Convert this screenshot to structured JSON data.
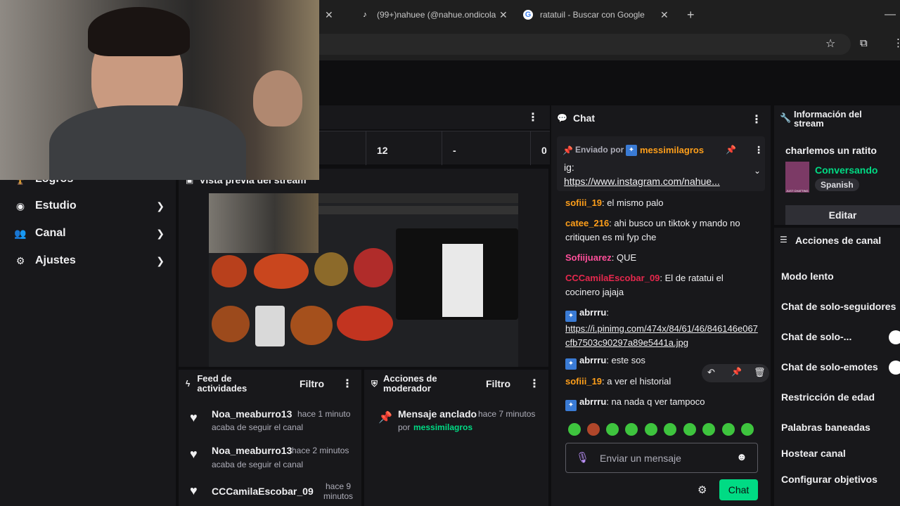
{
  "browser": {
    "tabs": [
      {
        "title": "(99+)nahuee (@nahue.ondicola",
        "icon": "tiktok-icon"
      },
      {
        "title": "ratatuil - Buscar con Google",
        "icon": "google-icon"
      }
    ]
  },
  "sidenav": {
    "items": [
      {
        "label": "Logros"
      },
      {
        "label": "Estudio"
      },
      {
        "label": "Canal"
      },
      {
        "label": "Ajustes"
      }
    ]
  },
  "stats": {
    "values": [
      "12",
      "-",
      "0"
    ]
  },
  "preview": {
    "title": "Vista previa del stream"
  },
  "feed": {
    "title": "Feed de actividades",
    "filter": "Filtro",
    "items": [
      {
        "user": "Noa_meaburro13",
        "time": "hace 1 minuto",
        "action": "acaba de seguir el canal"
      },
      {
        "user": "Noa_meaburro13",
        "time": "hace 2 minutos",
        "action": "acaba de seguir el canal"
      },
      {
        "user": "CCCamilaEscobar_09",
        "time": "hace 9 minutos",
        "action": ""
      }
    ]
  },
  "modactions": {
    "title": "Acciones de moderador",
    "filter": "Filtro",
    "pinned": {
      "label": "Mensaje anclado",
      "time": "hace 7 minutos",
      "by": "por",
      "user": "messimilagros"
    }
  },
  "chat": {
    "title": "Chat",
    "pinned": {
      "sent_by": "Enviado por",
      "user": "messimilagros",
      "text": "ig:",
      "link": "https://www.instagram.com/nahue..."
    },
    "messages": [
      {
        "user": "sofiii_19",
        "color": "#ff9f1a",
        "text": ": el mismo palo"
      },
      {
        "user": "catee_216",
        "color": "#ff9f1a",
        "text": ": ahi busco un tiktok y mando no critiquen es mi fyp che"
      },
      {
        "user": "Sofiijuarez",
        "color": "#ff4f9a",
        "text": ": QUE"
      },
      {
        "user": "CCCamilaEscobar_09",
        "color": "#e5284d",
        "text": ": El de ratatui el cocinero jajaja"
      },
      {
        "user": "abrrru",
        "color": "#efeff1",
        "text": ":",
        "link": "https://i.pinimg.com/474x/84/61/46/846146e067cfb7503c90297a89e5441a.jpg"
      },
      {
        "user": "abrrru",
        "color": "#efeff1",
        "text": ": este sos"
      },
      {
        "user": "sofiii_19",
        "color": "#ff9f1a",
        "text": ": a ver el historial"
      },
      {
        "user": "abrrru",
        "color": "#efeff1",
        "text": ": na nada q ver tampoco"
      }
    ],
    "input_placeholder": "Enviar un mensaje",
    "send_label": "Chat"
  },
  "stream_info": {
    "title": "Información del stream",
    "stream_title": "charlemos un ratito",
    "category": "Conversando",
    "tag": "Spanish",
    "edit_label": "Editar",
    "category_art_text": "JUST CHATTING"
  },
  "channel_actions": {
    "title": "Acciones de canal",
    "items": [
      {
        "label": "Modo lento"
      },
      {
        "label": "Chat de solo-seguidores"
      },
      {
        "label": "Chat de solo-..."
      },
      {
        "label": "Chat de solo-emotes"
      },
      {
        "label": "Restricción de edad"
      },
      {
        "label": "Palabras baneadas"
      },
      {
        "label": "Hostear canal"
      },
      {
        "label": "Configurar objetivos"
      }
    ]
  },
  "colors": {
    "accent": "#00db84",
    "link_user": "#ff9f1a",
    "bg": "#0e0e10",
    "panel": "#18181b"
  }
}
